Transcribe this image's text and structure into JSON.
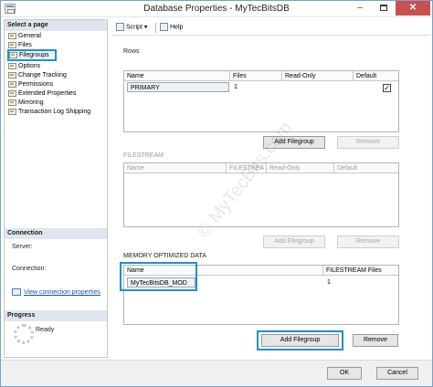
{
  "window": {
    "title": "Database Properties - MyTecBitsDB",
    "minimize": "–",
    "close": "✕"
  },
  "left_pane": {
    "select_page_header": "Select a page",
    "pages": [
      "General",
      "Files",
      "Filegroups",
      "Options",
      "Change Tracking",
      "Permissions",
      "Extended Properties",
      "Mirroring",
      "Transaction Log Shipping"
    ],
    "selected_page": "Filegroups",
    "connection_header": "Connection",
    "server_label": "Server:",
    "connection_label": "Connection:",
    "view_connection_link": "View connection properties",
    "progress_header": "Progress",
    "progress_status": "Ready"
  },
  "toolbar": {
    "script_label": "Script",
    "script_arrow": "▾",
    "help_label": "Help"
  },
  "rows_section": {
    "label": "Rows",
    "columns": [
      "Name",
      "Files",
      "Read-Only",
      "Default"
    ],
    "rows": [
      {
        "name": "PRIMARY",
        "files": "1",
        "read_only": false,
        "default": true
      }
    ],
    "add_label": "Add Filegroup",
    "remove_label": "Remove"
  },
  "filestream_section": {
    "label": "FILESTREAM",
    "columns": [
      "Name",
      "FILESTREA",
      "Read-Only",
      "Default"
    ],
    "add_label": "Add Filegroup",
    "remove_label": "Remove"
  },
  "memory_section": {
    "label": "MEMORY OPTIMIZED DATA",
    "columns": [
      "Name",
      "FILESTREAM Files"
    ],
    "rows": [
      {
        "name": "MyTecBitsDB_MOD",
        "files": "1"
      }
    ],
    "add_label": "Add Filegroup",
    "remove_label": "Remove"
  },
  "footer": {
    "ok_label": "OK",
    "cancel_label": "Cancel"
  },
  "watermark": "© MyTecBits.com",
  "colors": {
    "highlight": "#1f8fd0",
    "close_button": "#c75050",
    "section_header": "#dfe6ef",
    "link": "#1a4fa0"
  }
}
